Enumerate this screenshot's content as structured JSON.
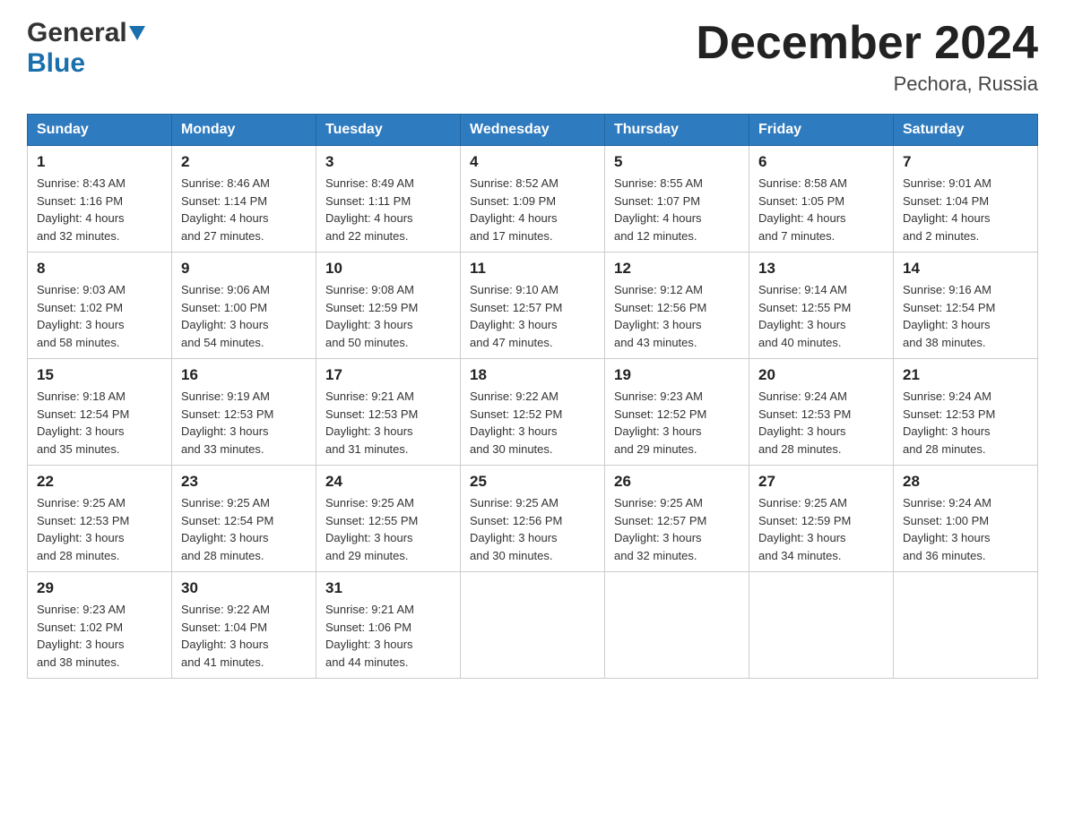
{
  "logo": {
    "general": "General",
    "blue": "Blue"
  },
  "title": "December 2024",
  "location": "Pechora, Russia",
  "weekdays": [
    "Sunday",
    "Monday",
    "Tuesday",
    "Wednesday",
    "Thursday",
    "Friday",
    "Saturday"
  ],
  "weeks": [
    [
      {
        "day": "1",
        "sunrise": "Sunrise: 8:43 AM",
        "sunset": "Sunset: 1:16 PM",
        "daylight": "Daylight: 4 hours",
        "daylight2": "and 32 minutes."
      },
      {
        "day": "2",
        "sunrise": "Sunrise: 8:46 AM",
        "sunset": "Sunset: 1:14 PM",
        "daylight": "Daylight: 4 hours",
        "daylight2": "and 27 minutes."
      },
      {
        "day": "3",
        "sunrise": "Sunrise: 8:49 AM",
        "sunset": "Sunset: 1:11 PM",
        "daylight": "Daylight: 4 hours",
        "daylight2": "and 22 minutes."
      },
      {
        "day": "4",
        "sunrise": "Sunrise: 8:52 AM",
        "sunset": "Sunset: 1:09 PM",
        "daylight": "Daylight: 4 hours",
        "daylight2": "and 17 minutes."
      },
      {
        "day": "5",
        "sunrise": "Sunrise: 8:55 AM",
        "sunset": "Sunset: 1:07 PM",
        "daylight": "Daylight: 4 hours",
        "daylight2": "and 12 minutes."
      },
      {
        "day": "6",
        "sunrise": "Sunrise: 8:58 AM",
        "sunset": "Sunset: 1:05 PM",
        "daylight": "Daylight: 4 hours",
        "daylight2": "and 7 minutes."
      },
      {
        "day": "7",
        "sunrise": "Sunrise: 9:01 AM",
        "sunset": "Sunset: 1:04 PM",
        "daylight": "Daylight: 4 hours",
        "daylight2": "and 2 minutes."
      }
    ],
    [
      {
        "day": "8",
        "sunrise": "Sunrise: 9:03 AM",
        "sunset": "Sunset: 1:02 PM",
        "daylight": "Daylight: 3 hours",
        "daylight2": "and 58 minutes."
      },
      {
        "day": "9",
        "sunrise": "Sunrise: 9:06 AM",
        "sunset": "Sunset: 1:00 PM",
        "daylight": "Daylight: 3 hours",
        "daylight2": "and 54 minutes."
      },
      {
        "day": "10",
        "sunrise": "Sunrise: 9:08 AM",
        "sunset": "Sunset: 12:59 PM",
        "daylight": "Daylight: 3 hours",
        "daylight2": "and 50 minutes."
      },
      {
        "day": "11",
        "sunrise": "Sunrise: 9:10 AM",
        "sunset": "Sunset: 12:57 PM",
        "daylight": "Daylight: 3 hours",
        "daylight2": "and 47 minutes."
      },
      {
        "day": "12",
        "sunrise": "Sunrise: 9:12 AM",
        "sunset": "Sunset: 12:56 PM",
        "daylight": "Daylight: 3 hours",
        "daylight2": "and 43 minutes."
      },
      {
        "day": "13",
        "sunrise": "Sunrise: 9:14 AM",
        "sunset": "Sunset: 12:55 PM",
        "daylight": "Daylight: 3 hours",
        "daylight2": "and 40 minutes."
      },
      {
        "day": "14",
        "sunrise": "Sunrise: 9:16 AM",
        "sunset": "Sunset: 12:54 PM",
        "daylight": "Daylight: 3 hours",
        "daylight2": "and 38 minutes."
      }
    ],
    [
      {
        "day": "15",
        "sunrise": "Sunrise: 9:18 AM",
        "sunset": "Sunset: 12:54 PM",
        "daylight": "Daylight: 3 hours",
        "daylight2": "and 35 minutes."
      },
      {
        "day": "16",
        "sunrise": "Sunrise: 9:19 AM",
        "sunset": "Sunset: 12:53 PM",
        "daylight": "Daylight: 3 hours",
        "daylight2": "and 33 minutes."
      },
      {
        "day": "17",
        "sunrise": "Sunrise: 9:21 AM",
        "sunset": "Sunset: 12:53 PM",
        "daylight": "Daylight: 3 hours",
        "daylight2": "and 31 minutes."
      },
      {
        "day": "18",
        "sunrise": "Sunrise: 9:22 AM",
        "sunset": "Sunset: 12:52 PM",
        "daylight": "Daylight: 3 hours",
        "daylight2": "and 30 minutes."
      },
      {
        "day": "19",
        "sunrise": "Sunrise: 9:23 AM",
        "sunset": "Sunset: 12:52 PM",
        "daylight": "Daylight: 3 hours",
        "daylight2": "and 29 minutes."
      },
      {
        "day": "20",
        "sunrise": "Sunrise: 9:24 AM",
        "sunset": "Sunset: 12:53 PM",
        "daylight": "Daylight: 3 hours",
        "daylight2": "and 28 minutes."
      },
      {
        "day": "21",
        "sunrise": "Sunrise: 9:24 AM",
        "sunset": "Sunset: 12:53 PM",
        "daylight": "Daylight: 3 hours",
        "daylight2": "and 28 minutes."
      }
    ],
    [
      {
        "day": "22",
        "sunrise": "Sunrise: 9:25 AM",
        "sunset": "Sunset: 12:53 PM",
        "daylight": "Daylight: 3 hours",
        "daylight2": "and 28 minutes."
      },
      {
        "day": "23",
        "sunrise": "Sunrise: 9:25 AM",
        "sunset": "Sunset: 12:54 PM",
        "daylight": "Daylight: 3 hours",
        "daylight2": "and 28 minutes."
      },
      {
        "day": "24",
        "sunrise": "Sunrise: 9:25 AM",
        "sunset": "Sunset: 12:55 PM",
        "daylight": "Daylight: 3 hours",
        "daylight2": "and 29 minutes."
      },
      {
        "day": "25",
        "sunrise": "Sunrise: 9:25 AM",
        "sunset": "Sunset: 12:56 PM",
        "daylight": "Daylight: 3 hours",
        "daylight2": "and 30 minutes."
      },
      {
        "day": "26",
        "sunrise": "Sunrise: 9:25 AM",
        "sunset": "Sunset: 12:57 PM",
        "daylight": "Daylight: 3 hours",
        "daylight2": "and 32 minutes."
      },
      {
        "day": "27",
        "sunrise": "Sunrise: 9:25 AM",
        "sunset": "Sunset: 12:59 PM",
        "daylight": "Daylight: 3 hours",
        "daylight2": "and 34 minutes."
      },
      {
        "day": "28",
        "sunrise": "Sunrise: 9:24 AM",
        "sunset": "Sunset: 1:00 PM",
        "daylight": "Daylight: 3 hours",
        "daylight2": "and 36 minutes."
      }
    ],
    [
      {
        "day": "29",
        "sunrise": "Sunrise: 9:23 AM",
        "sunset": "Sunset: 1:02 PM",
        "daylight": "Daylight: 3 hours",
        "daylight2": "and 38 minutes."
      },
      {
        "day": "30",
        "sunrise": "Sunrise: 9:22 AM",
        "sunset": "Sunset: 1:04 PM",
        "daylight": "Daylight: 3 hours",
        "daylight2": "and 41 minutes."
      },
      {
        "day": "31",
        "sunrise": "Sunrise: 9:21 AM",
        "sunset": "Sunset: 1:06 PM",
        "daylight": "Daylight: 3 hours",
        "daylight2": "and 44 minutes."
      },
      null,
      null,
      null,
      null
    ]
  ]
}
